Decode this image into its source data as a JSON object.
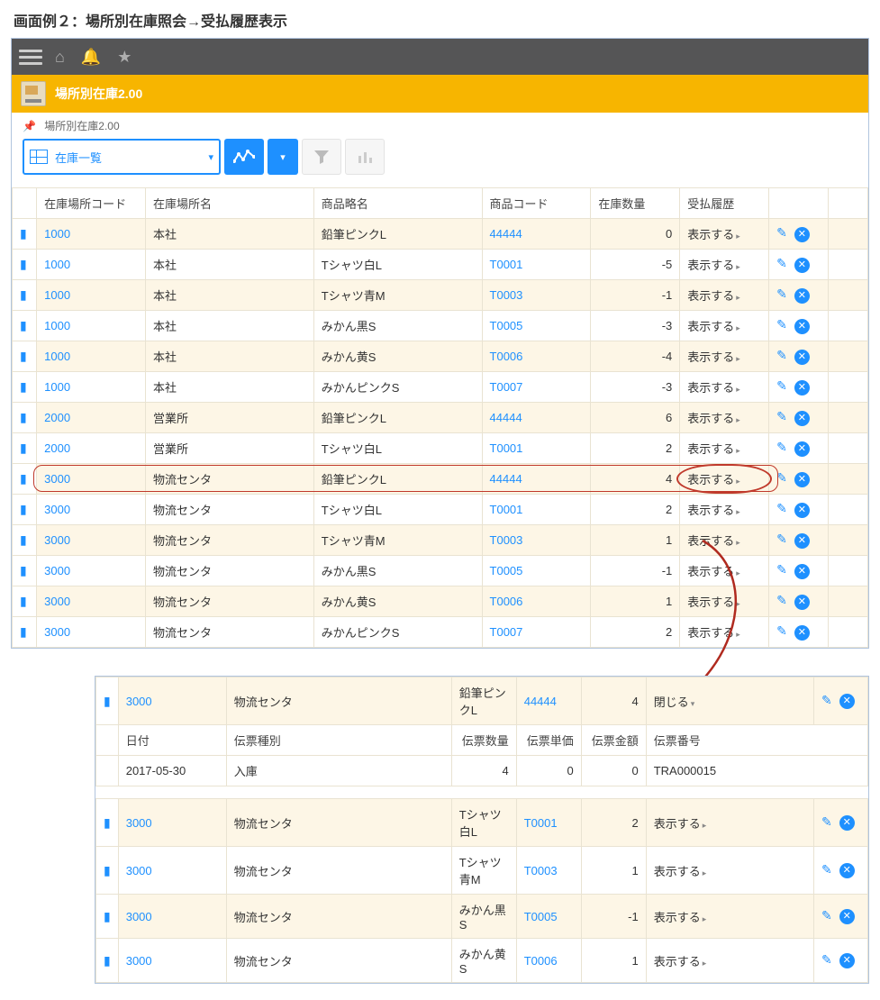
{
  "heading": "画面例２：場所別在庫照会→受払履歴表示",
  "page": {
    "title": "場所別在庫2.00",
    "crumb": "場所別在庫2.00"
  },
  "toolbar": {
    "view_select": "在庫一覧"
  },
  "columns": {
    "loc_code": "在庫場所コード",
    "loc_name": "在庫場所名",
    "prod_name": "商品略名",
    "prod_code": "商品コード",
    "qty": "在庫数量",
    "history": "受払履歴"
  },
  "show_label": "表示する",
  "close_label": "閉じる",
  "rows": [
    {
      "loc_code": "1000",
      "loc_name": "本社",
      "prod_name": "鉛筆ピンクL",
      "prod_code": "44444",
      "qty": "0"
    },
    {
      "loc_code": "1000",
      "loc_name": "本社",
      "prod_name": "Tシャツ白L",
      "prod_code": "T0001",
      "qty": "-5"
    },
    {
      "loc_code": "1000",
      "loc_name": "本社",
      "prod_name": "Tシャツ青M",
      "prod_code": "T0003",
      "qty": "-1"
    },
    {
      "loc_code": "1000",
      "loc_name": "本社",
      "prod_name": "みかん黒S",
      "prod_code": "T0005",
      "qty": "-3"
    },
    {
      "loc_code": "1000",
      "loc_name": "本社",
      "prod_name": "みかん黄S",
      "prod_code": "T0006",
      "qty": "-4"
    },
    {
      "loc_code": "1000",
      "loc_name": "本社",
      "prod_name": "みかんピンクS",
      "prod_code": "T0007",
      "qty": "-3"
    },
    {
      "loc_code": "2000",
      "loc_name": "営業所",
      "prod_name": "鉛筆ピンクL",
      "prod_code": "44444",
      "qty": "6"
    },
    {
      "loc_code": "2000",
      "loc_name": "営業所",
      "prod_name": "Tシャツ白L",
      "prod_code": "T0001",
      "qty": "2"
    },
    {
      "loc_code": "3000",
      "loc_name": "物流センタ",
      "prod_name": "鉛筆ピンクL",
      "prod_code": "44444",
      "qty": "4",
      "hl": true
    },
    {
      "loc_code": "3000",
      "loc_name": "物流センタ",
      "prod_name": "Tシャツ白L",
      "prod_code": "T0001",
      "qty": "2"
    },
    {
      "loc_code": "3000",
      "loc_name": "物流センタ",
      "prod_name": "Tシャツ青M",
      "prod_code": "T0003",
      "qty": "1"
    },
    {
      "loc_code": "3000",
      "loc_name": "物流センタ",
      "prod_name": "みかん黒S",
      "prod_code": "T0005",
      "qty": "-1"
    },
    {
      "loc_code": "3000",
      "loc_name": "物流センタ",
      "prod_name": "みかん黄S",
      "prod_code": "T0006",
      "qty": "1"
    },
    {
      "loc_code": "3000",
      "loc_name": "物流センタ",
      "prod_name": "みかんピンクS",
      "prod_code": "T0007",
      "qty": "2"
    }
  ],
  "detail": {
    "header": {
      "loc_code": "3000",
      "loc_name": "物流センタ",
      "prod_name": "鉛筆ピンクL",
      "prod_code": "44444",
      "qty": "4"
    },
    "cols": {
      "date": "日付",
      "kind": "伝票種別",
      "dqty": "伝票数量",
      "dprice": "伝票単価",
      "damt": "伝票金額",
      "dno": "伝票番号"
    },
    "entries": [
      {
        "date": "2017-05-30",
        "kind": "入庫",
        "dqty": "4",
        "dprice": "0",
        "damt": "0",
        "dno": "TRA000015"
      }
    ],
    "after_rows": [
      {
        "loc_code": "3000",
        "loc_name": "物流センタ",
        "prod_name": "Tシャツ白L",
        "prod_code": "T0001",
        "qty": "2"
      },
      {
        "loc_code": "3000",
        "loc_name": "物流センタ",
        "prod_name": "Tシャツ青M",
        "prod_code": "T0003",
        "qty": "1"
      },
      {
        "loc_code": "3000",
        "loc_name": "物流センタ",
        "prod_name": "みかん黒S",
        "prod_code": "T0005",
        "qty": "-1"
      },
      {
        "loc_code": "3000",
        "loc_name": "物流センタ",
        "prod_name": "みかん黄S",
        "prod_code": "T0006",
        "qty": "1"
      }
    ]
  }
}
